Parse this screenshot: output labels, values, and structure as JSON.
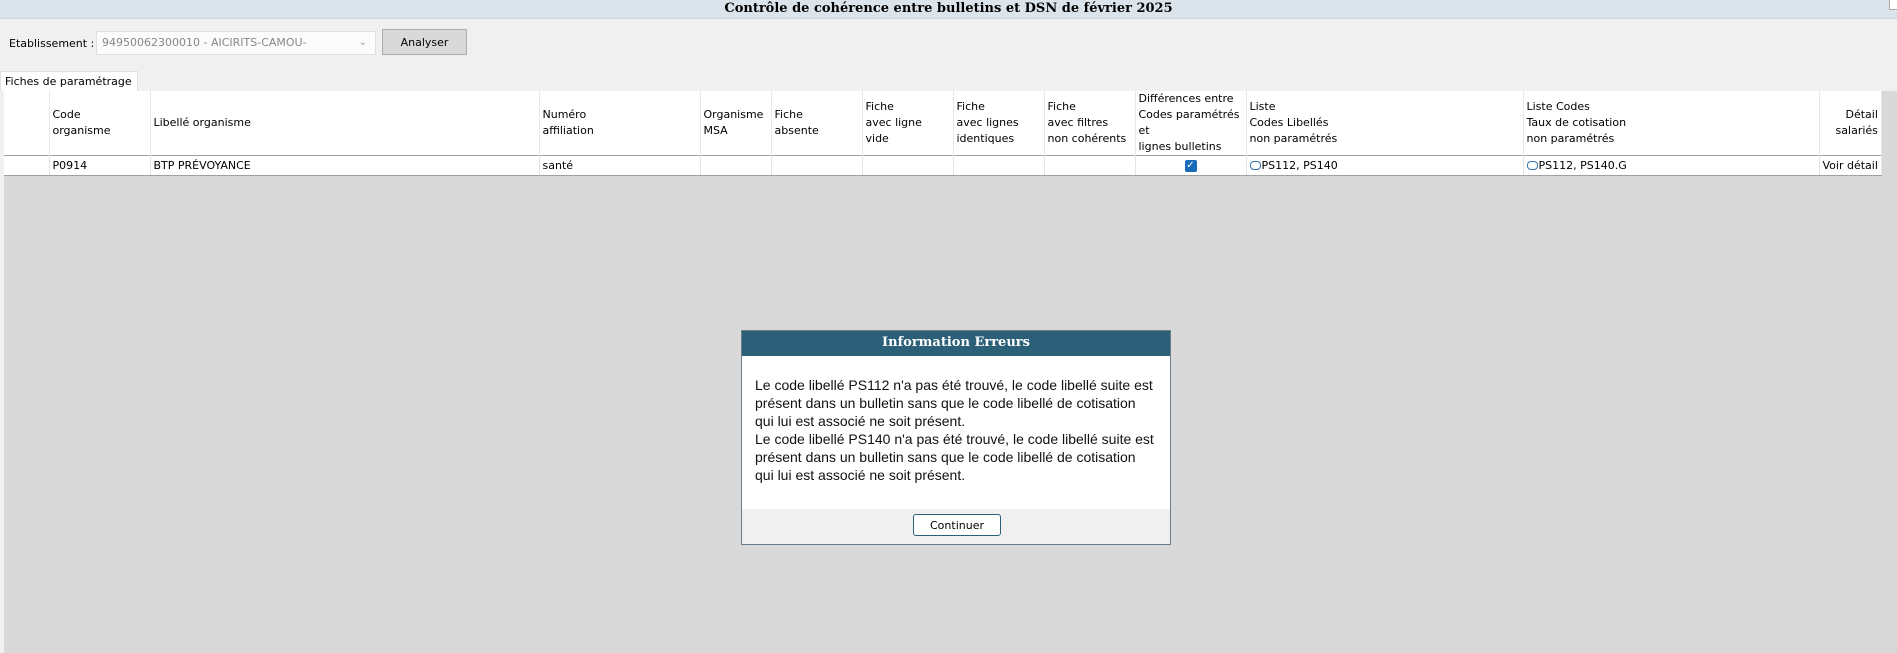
{
  "window": {
    "title": "Contrôle de cohérence entre bulletins et DSN de février 2025"
  },
  "toolbar": {
    "etablissement_label": "Etablissement :",
    "etablissement_value": "94950062300010 - AICIRITS-CAMOU-",
    "analyser_label": "Analyser"
  },
  "tabs": [
    {
      "label": "Fiches de paramétrage"
    }
  ],
  "grid": {
    "columns": [
      "",
      "Code\norganisme",
      "Libellé organisme",
      "Numéro\n affiliation",
      "Organisme\nMSA",
      "Fiche\nabsente",
      "Fiche\navec ligne\nvide",
      "Fiche\navec lignes\nidentiques",
      "Fiche\navec filtres\nnon cohérents",
      "Différences entre\nCodes paramétrés et\nlignes bulletins",
      "Liste\n Codes Libellés\nnon paramétrés",
      "Liste Codes\nTaux de cotisation\nnon paramétrés",
      "Détail\nsalariés"
    ],
    "rows": [
      {
        "code": "P0914",
        "libelle": "BTP PRÉVOYANCE",
        "numero": "santé",
        "msa": "",
        "absente": "",
        "ligne_vide": "",
        "identiques": "",
        "filtres": "",
        "difference_checked": "✓",
        "codes_libelles": "PS112, PS140",
        "codes_taux": "PS112, PS140.G",
        "detail": "Voir détail"
      }
    ]
  },
  "modal": {
    "title": "Information Erreurs",
    "message_1": "Le code libellé PS112 n'a pas été trouvé, le code libellé suite est présent dans un bulletin sans que le code libellé de cotisation qui lui est associé ne soit présent.",
    "message_2": "Le code libellé PS140 n'a pas été trouvé, le code libellé suite est présent dans un bulletin sans que le code libellé de cotisation qui lui est associé ne soit présent.",
    "continue_label": "Continuer"
  }
}
